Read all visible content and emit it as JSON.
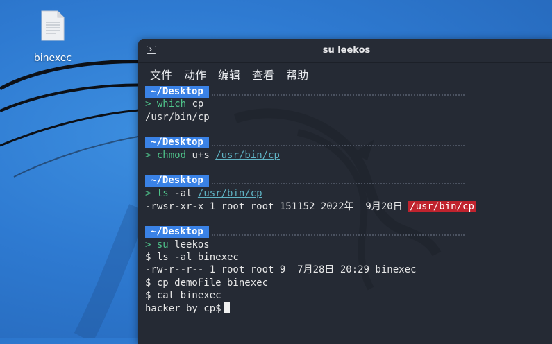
{
  "desktop": {
    "icon_label": "binexec",
    "icon_name": "file-icon"
  },
  "window": {
    "title": "su leekos",
    "menu": [
      "文件",
      "动作",
      "编辑",
      "查看",
      "帮助"
    ]
  },
  "terminal": {
    "prompt_label": "~/Desktop",
    "prompt_arrow": ">",
    "blocks": [
      {
        "command": "which",
        "args": " cp",
        "output": "/usr/bin/cp"
      },
      {
        "command": "chmod",
        "args": " u+s ",
        "path": "/usr/bin/cp"
      },
      {
        "command": "ls",
        "args": " -al ",
        "path": "/usr/bin/cp",
        "output_text": "-rwsr-xr-x 1 root root 151152 2022年  9月20日 ",
        "output_highlight": "/usr/bin/cp"
      },
      {
        "command": "su",
        "args": " leekos"
      }
    ],
    "session_lines": [
      "$ ls -al binexec",
      "-rw-r--r-- 1 root root 9  7月28日 20:29 binexec",
      "$ cp demoFile binexec",
      "$ cat binexec"
    ],
    "last_line": "hacker by cp$"
  },
  "colors": {
    "desktop_bg": "#2e7ad1",
    "terminal_bg": "#252a34",
    "prompt_badge": "#3a82e6",
    "command_green": "#4fc38a",
    "path_cyan": "#5fb3c4",
    "highlight_red": "#c0232e"
  }
}
